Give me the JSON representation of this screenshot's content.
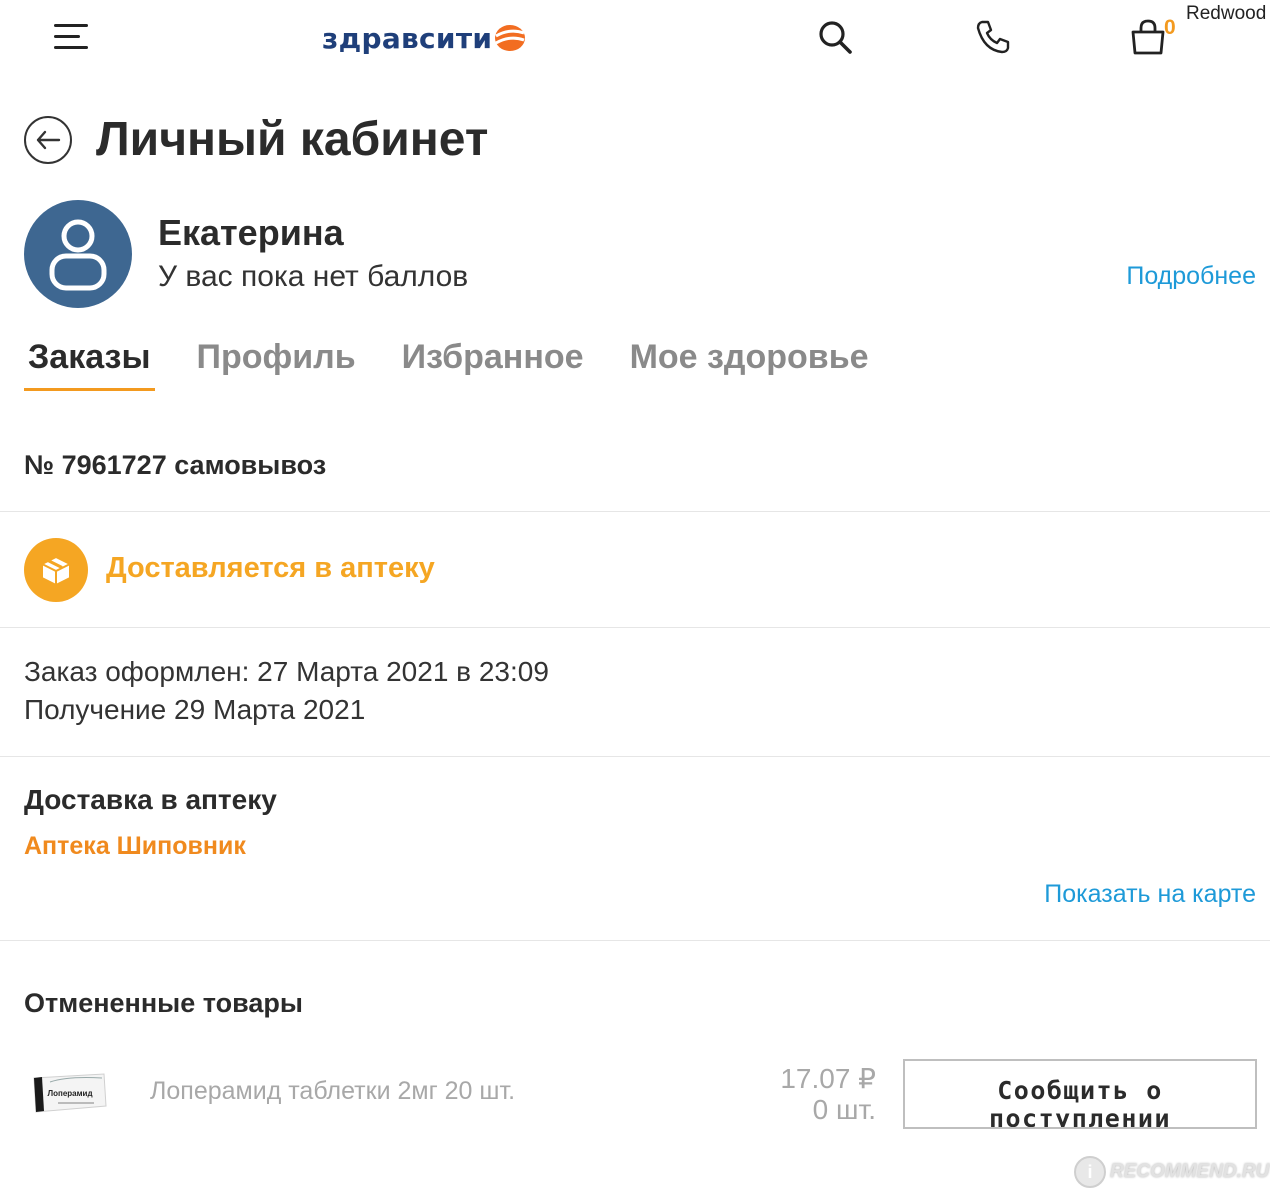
{
  "header": {
    "logo_text": "здравсити",
    "cart_count": "0",
    "overlay_user": "Redwood"
  },
  "page": {
    "title": "Личный кабинет"
  },
  "user": {
    "name": "Екатерина",
    "points_text": "У вас пока нет баллов",
    "more_link": "Подробнее"
  },
  "tabs": [
    {
      "label": "Заказы",
      "active": true
    },
    {
      "label": "Профиль",
      "active": false
    },
    {
      "label": "Избранное",
      "active": false
    },
    {
      "label": "Мое здоровье",
      "active": false
    }
  ],
  "order": {
    "number": "№ 7961727 самовывоз",
    "status": "Доставляется в аптеку",
    "placed": "Заказ оформлен: 27 Марта 2021 в 23:09",
    "pickup": "Получение 29 Марта 2021",
    "delivery_title": "Доставка в аптеку",
    "pharmacy": "Аптека Шиповник",
    "map_link": "Показать на карте"
  },
  "cancelled": {
    "title": "Отмененные товары",
    "items": [
      {
        "name": "Лоперамид таблетки 2мг 20 шт.",
        "package_label": "Лоперамид",
        "price": "17.07 ₽",
        "qty": "0 шт.",
        "button": "Сообщить о поступлении"
      }
    ]
  },
  "watermark": {
    "badge": "i",
    "text": "RECOMMEND.RU"
  },
  "colors": {
    "accent_orange": "#f39a1f",
    "link_blue": "#1e9ad8",
    "logo_blue": "#1f3f7a",
    "avatar_bg": "#3e6791",
    "status_orange": "#f5a623"
  },
  "icons": [
    "menu-icon",
    "search-icon",
    "phone-icon",
    "cart-icon",
    "back-arrow-icon",
    "user-icon",
    "box-icon"
  ]
}
